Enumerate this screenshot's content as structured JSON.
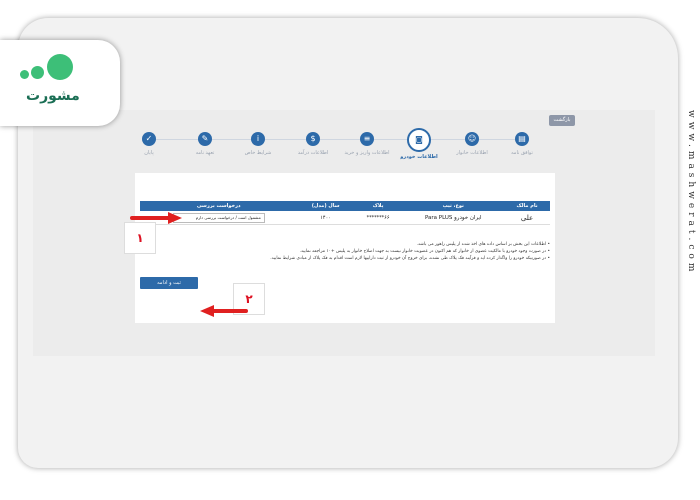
{
  "site_url": "www.mashwerat.com",
  "logo": {
    "wordmark": "مشورت"
  },
  "back_button": "بازگشت",
  "steps": [
    {
      "label": "توافق نامه",
      "icon": "document-icon",
      "active": false
    },
    {
      "label": "اطلاعات خانوار",
      "icon": "people-icon",
      "active": false
    },
    {
      "label": "اطلاعات خودرو",
      "icon": "car-icon",
      "active": true
    },
    {
      "label": "اطلاعات واریز و خرید",
      "icon": "list-icon",
      "active": false
    },
    {
      "label": "اطلاعات درآمد",
      "icon": "money-bag-icon",
      "active": false
    },
    {
      "label": "شرایط خاص",
      "icon": "info-icon",
      "active": false
    },
    {
      "label": "تعهد نامه",
      "icon": "pen-icon",
      "active": false
    },
    {
      "label": "پایان",
      "icon": "check-icon",
      "active": false
    }
  ],
  "table": {
    "headers": [
      "نام مالک",
      "نوع، تیپ",
      "پلاک",
      "سال (مدل)",
      "درخواست بررسی"
    ],
    "row": {
      "owner": "علی",
      "car": "ایران خودرو Para PLUS",
      "plate": "۶۶*******",
      "year": "۱۴۰۰",
      "request_option": "مشمول است / درخواست بررسی دارم"
    }
  },
  "notes": [
    "• اطلاعات این بخش بر اساس داده های اخذ شده از پلیس راهور می باشد.",
    "• در صورت وجود خودرو با مالکیت عضوی از خانوار که هم اکنون در عضویت خانوار نیست به جهت اصلاح خانوار به پلیس +۱۰ مراجعه نمایید.",
    "• در صورتیکه خودرو را واگذار کرده اید و فرآیند فک پلاک طی نشده، برای خروج آن خودرو از ثبت داراییها لازم است اقدام به فک پلاک از مبادی شرایط نمایید."
  ],
  "submit_button": "ثبت و ادامه",
  "annotations": {
    "one": "۱",
    "two": "۲"
  },
  "colors": {
    "primary": "#2d6aa9",
    "arrow": "#e02020",
    "logo_green": "#3dbf78"
  }
}
